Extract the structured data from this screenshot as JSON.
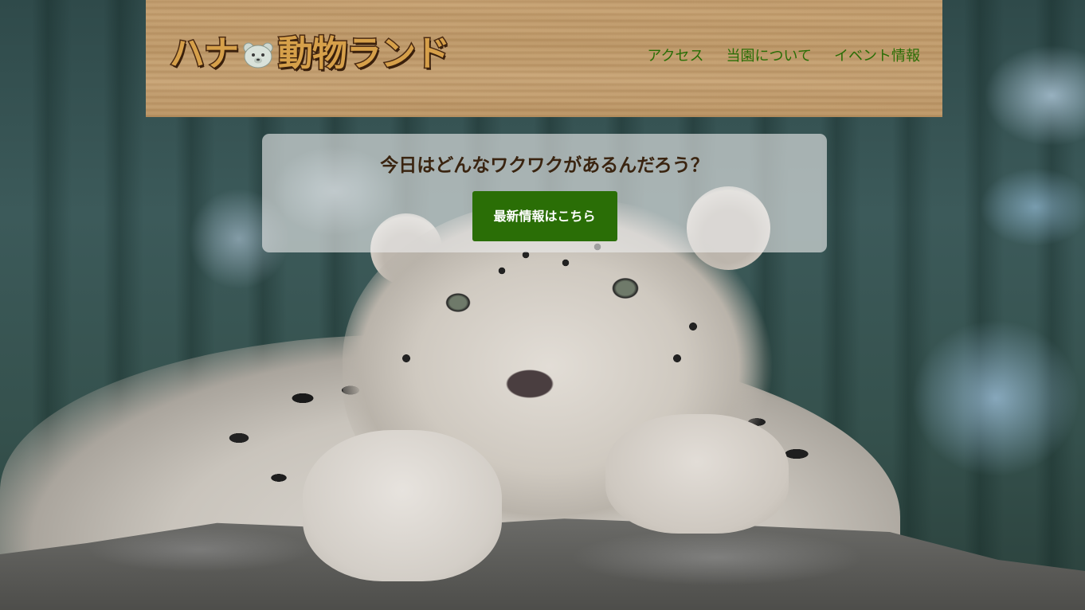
{
  "header": {
    "logo_text_left": "ハナ",
    "logo_text_right": "動物ランド",
    "logo_icon": "bear-face-icon",
    "nav": [
      {
        "label": "アクセス"
      },
      {
        "label": "当園について"
      },
      {
        "label": "イベント情報"
      }
    ]
  },
  "hero": {
    "title": "今日はどんなワクワクがあるんだろう？",
    "cta_label": "最新情報はこちら",
    "background_image": "snow-leopard-photo"
  },
  "colors": {
    "nav_link": "#2a6e06",
    "cta_background": "#2a6e06",
    "cta_text": "#ffffff",
    "hero_title": "#3a2410",
    "logo_fill": "#d6a04a",
    "logo_outline": "#4a2a12"
  }
}
